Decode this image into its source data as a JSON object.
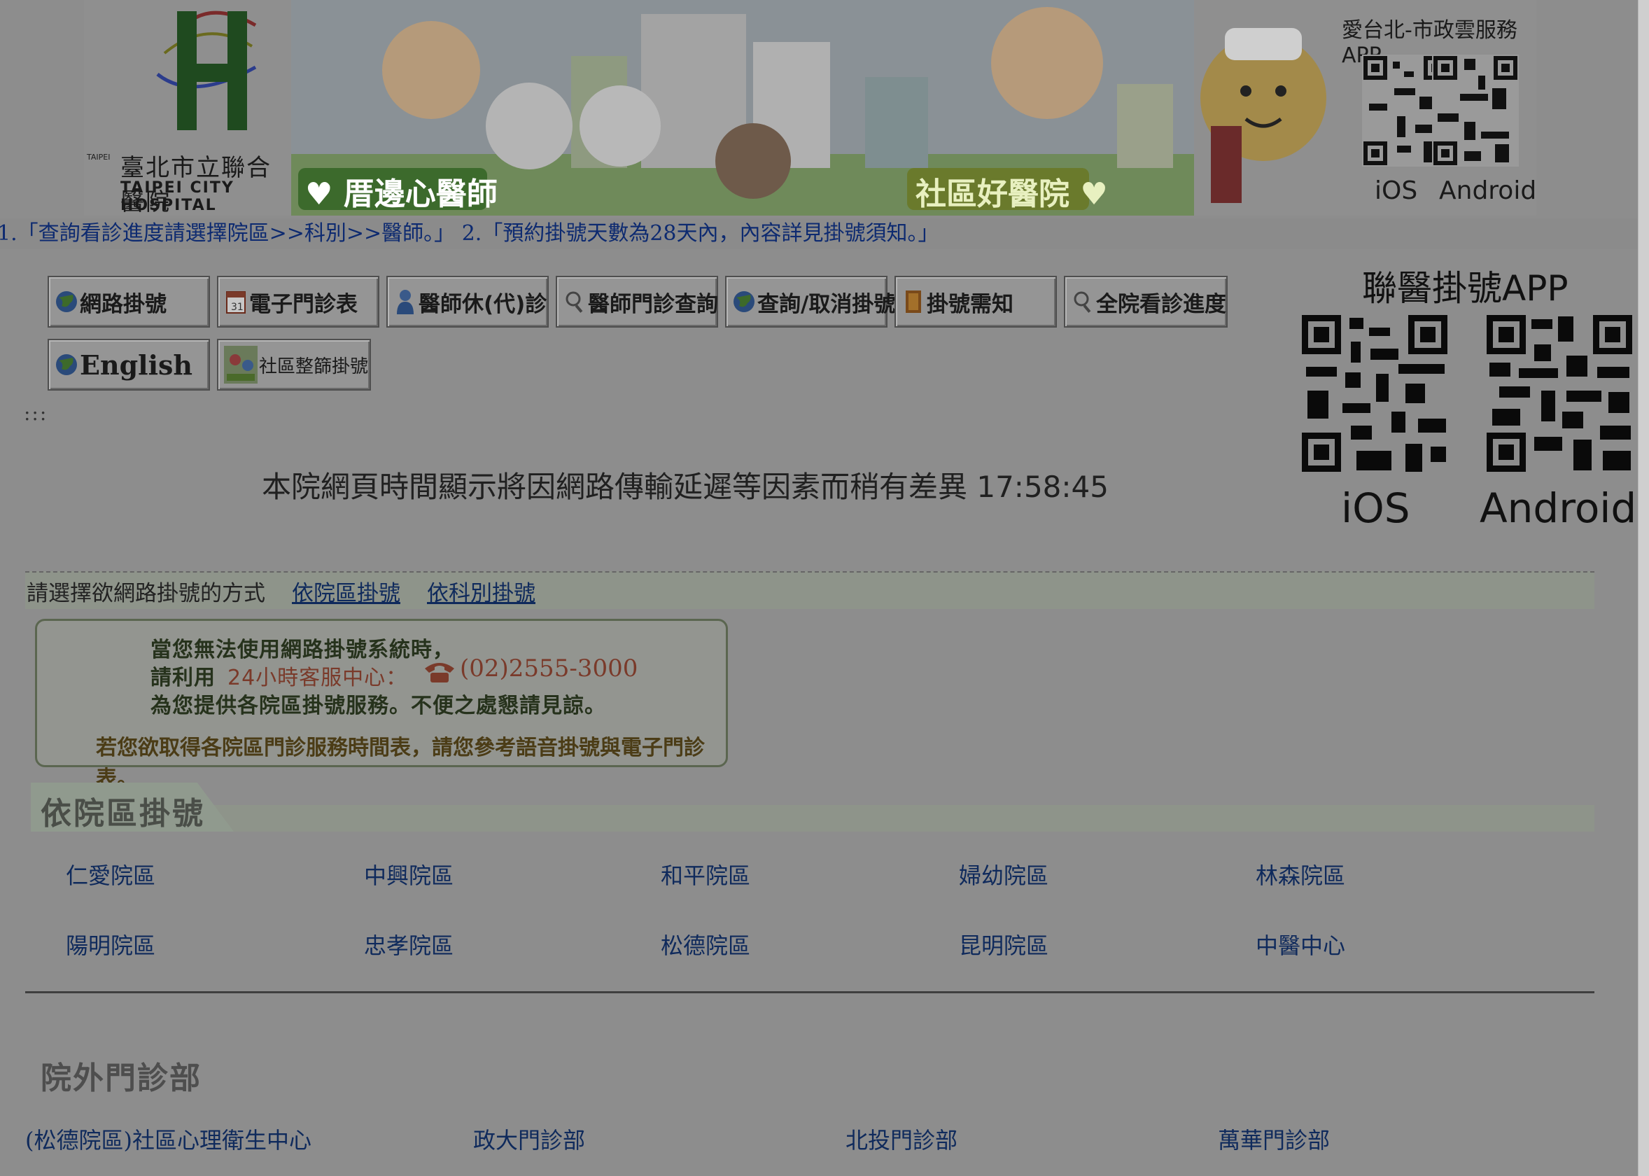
{
  "banner": {
    "logo_zh": "臺北市立聯合醫院",
    "logo_en": "TAIPEI CITY HOSPITAL",
    "logo_mark": "TAIPEI",
    "slogan_left": "♥ 厝邊心醫師",
    "slogan_right": "社區好醫院 ♥",
    "app_title": "愛台北-市政雲服務APP",
    "app_ios": "iOS",
    "app_android": "Android"
  },
  "marquee": {
    "text": "1.「查詢看診進度請選擇院區>>科別>>醫師。」 2.「預約掛號天數為28天內，內容詳見掛號須知。」"
  },
  "nav": {
    "buttons": [
      {
        "label": "網路掛號",
        "icon": "globe-icon"
      },
      {
        "label": "電子門診表",
        "icon": "calendar-icon"
      },
      {
        "label": "醫師休(代)診",
        "icon": "doctor-icon"
      },
      {
        "label": "醫師門診查詢",
        "icon": "magnifier-icon"
      },
      {
        "label": "查詢/取消掛號",
        "icon": "globe-icon"
      },
      {
        "label": "掛號需知",
        "icon": "book-icon"
      },
      {
        "label": "全院看診進度",
        "icon": "magnifier-icon"
      },
      {
        "label": "English",
        "icon": "globe-icon"
      },
      {
        "label": "社區整篩掛號",
        "icon": "community-icon"
      }
    ]
  },
  "anchor": ":::",
  "time_notice": "本院網頁時間顯示將因網路傳輸延遲等因素而稍有差異 17:58:45",
  "app2": {
    "title": "聯醫掛號APP",
    "ios": "iOS",
    "android": "Android"
  },
  "method": {
    "label": "請選擇欲網路掛號的方式",
    "link_branch": "依院區掛號",
    "link_dept": "依科別掛號"
  },
  "callout": {
    "line1": "當您無法使用網路掛號系統時，",
    "line2_a": "請利用",
    "line2_b": "24小時客服中心：",
    "phone": "(02)2555-3000",
    "line3": "為您提供各院區掛號服務。不便之處懇請見諒。",
    "footer": "若您欲取得各院區門診服務時間表，請您參考語音掛號與電子門診表。"
  },
  "branches": {
    "title": "依院區掛號",
    "items": [
      "仁愛院區",
      "中興院區",
      "和平院區",
      "婦幼院區",
      "林森院區",
      "陽明院區",
      "忠孝院區",
      "松德院區",
      "昆明院區",
      "中醫中心"
    ]
  },
  "outpatient": {
    "title": "院外門診部",
    "items": [
      "(松德院區)社區心理衛生中心",
      "政大門診部",
      "北投門診部",
      "萬華門診部"
    ]
  },
  "colors": {
    "link": "#0f2a5c",
    "overlay": "#8d8d8d",
    "accent_green": "#2e7d32"
  }
}
